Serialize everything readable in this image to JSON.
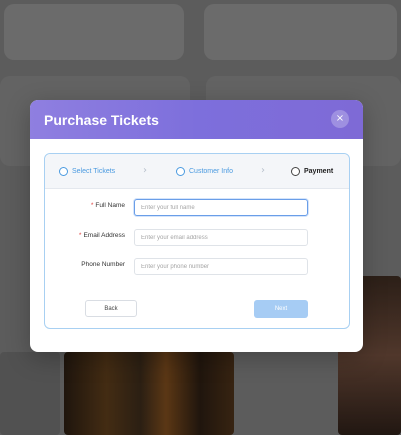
{
  "modal": {
    "title": "Purchase Tickets",
    "close_glyph": "×"
  },
  "steps": [
    {
      "label": "Select Tickets",
      "state": "pending"
    },
    {
      "label": "Customer Info",
      "state": "pending"
    },
    {
      "label": "Payment",
      "state": "active"
    }
  ],
  "form": {
    "full_name": {
      "label": "Full Name",
      "required": "*",
      "placeholder": "Enter your full name",
      "value": ""
    },
    "email": {
      "label": "Email Address",
      "required": "*",
      "placeholder": "Enter your email address",
      "value": ""
    },
    "phone": {
      "label": "Phone Number",
      "placeholder": "Enter your phone number",
      "value": ""
    }
  },
  "buttons": {
    "back": "Back",
    "next": "Next"
  },
  "colors": {
    "header_gradient_start": "#8f7fe0",
    "header_gradient_end": "#7e6ad6",
    "step_accent": "#4a9ae0",
    "next_button": "#a6ccf4",
    "required": "#e0413e"
  }
}
